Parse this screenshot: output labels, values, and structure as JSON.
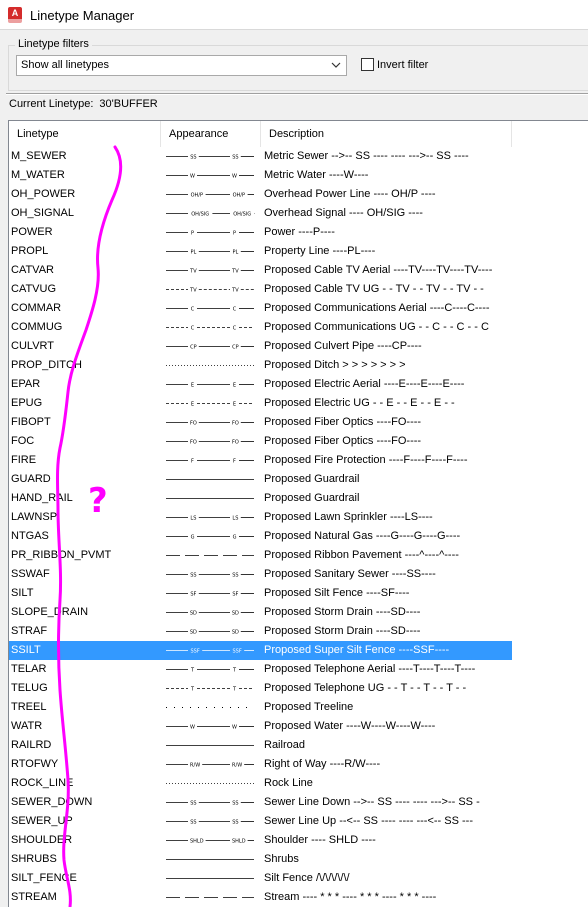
{
  "window": {
    "title": "Linetype Manager",
    "app_icon": "autocad-icon"
  },
  "filters": {
    "group_label": "Linetype filters",
    "selected": "Show all linetypes",
    "invert_label": "Invert filter",
    "invert_checked": false
  },
  "current": {
    "label": "Current Linetype:",
    "value": "30'BUFFER"
  },
  "columns": {
    "linetype": "Linetype",
    "appearance": "Appearance",
    "description": "Description"
  },
  "linetypes": [
    {
      "name": "M_SEWER",
      "desc": "Metric Sewer -->-- SS ---- ---- --->-- SS ----",
      "label": "SS",
      "pattern": "label"
    },
    {
      "name": "M_WATER",
      "desc": "Metric Water ----W----",
      "label": "W",
      "pattern": "label"
    },
    {
      "name": "OH_POWER",
      "desc": "Overhead Power Line ---- OH/P ----",
      "label": "OH/P",
      "pattern": "label"
    },
    {
      "name": "OH_SIGNAL",
      "desc": "Overhead Signal ---- OH/SIG ----",
      "label": "OH/SIG",
      "pattern": "label"
    },
    {
      "name": "POWER",
      "desc": "Power ----P----",
      "label": "P",
      "pattern": "label"
    },
    {
      "name": "PROPL",
      "desc": "Property Line ----PL----",
      "label": "PL",
      "pattern": "label"
    },
    {
      "name": "CATVAR",
      "desc": "Proposed Cable TV Aerial ----TV----TV----TV----",
      "label": "TV",
      "pattern": "label"
    },
    {
      "name": "CATVUG",
      "desc": "Proposed Cable TV UG - - TV - - TV - - TV - -",
      "label": "TV",
      "pattern": "label-dash"
    },
    {
      "name": "COMMAR",
      "desc": "Proposed Communications Aerial ----C----C----",
      "label": "C",
      "pattern": "label"
    },
    {
      "name": "COMMUG",
      "desc": "Proposed Communications UG - - C - - C - - C",
      "label": "C",
      "pattern": "label-dash"
    },
    {
      "name": "CULVRT",
      "desc": "Proposed Culvert Pipe ----CP----",
      "label": "CP",
      "pattern": "label"
    },
    {
      "name": "PROP_DITCH",
      "desc": "Proposed Ditch > > > > > > >",
      "label": "",
      "pattern": "dots"
    },
    {
      "name": "EPAR",
      "desc": "Proposed Electric Aerial ----E----E----E----",
      "label": "E",
      "pattern": "label"
    },
    {
      "name": "EPUG",
      "desc": "Proposed Electric UG - - E - - E - - E - -",
      "label": "E",
      "pattern": "label-dash"
    },
    {
      "name": "FIBOPT",
      "desc": "Proposed Fiber Optics ----FO----",
      "label": "FO",
      "pattern": "label"
    },
    {
      "name": "FOC",
      "desc": "Proposed Fiber Optics ----FO----",
      "label": "FO",
      "pattern": "label"
    },
    {
      "name": "FIRE",
      "desc": "Proposed Fire Protection ----F----F----F----",
      "label": "F",
      "pattern": "label"
    },
    {
      "name": "GUARD",
      "desc": "Proposed Guardrail",
      "label": "",
      "pattern": "solid"
    },
    {
      "name": "HAND_RAIL",
      "desc": "Proposed Guardrail",
      "label": "",
      "pattern": "solid"
    },
    {
      "name": "LAWNSP",
      "desc": "Proposed Lawn Sprinkler ----LS----",
      "label": "LS",
      "pattern": "label"
    },
    {
      "name": "NTGAS",
      "desc": "Proposed Natural Gas ----G----G----G----",
      "label": "G",
      "pattern": "label"
    },
    {
      "name": "PR_RIBBON_PVMT",
      "desc": "Proposed Ribbon Pavement ----^----^----",
      "label": "",
      "pattern": "long-dash"
    },
    {
      "name": "SSWAF",
      "desc": "Proposed Sanitary Sewer ----SS----",
      "label": "SS",
      "pattern": "label"
    },
    {
      "name": "SILT",
      "desc": "Proposed Silt Fence ----SF----",
      "label": "SF",
      "pattern": "label"
    },
    {
      "name": "SLOPE_DRAIN",
      "desc": "Proposed Storm Drain ----SD----",
      "label": "SD",
      "pattern": "label"
    },
    {
      "name": "STRAF",
      "desc": "Proposed Storm Drain ----SD----",
      "label": "SD",
      "pattern": "label"
    },
    {
      "name": "SSILT",
      "desc": "Proposed Super Silt Fence ----SSF----",
      "label": "SSF",
      "pattern": "label",
      "selected": true
    },
    {
      "name": "TELAR",
      "desc": "Proposed Telephone Aerial ----T----T----T----",
      "label": "T",
      "pattern": "label"
    },
    {
      "name": "TELUG",
      "desc": "Proposed Telephone UG - - T - - T - - T - -",
      "label": "T",
      "pattern": "label-dash"
    },
    {
      "name": "TREEL",
      "desc": "Proposed Treeline",
      "label": "",
      "pattern": "sparse-dots"
    },
    {
      "name": "WATR",
      "desc": "Proposed Water ----W----W----W----",
      "label": "W",
      "pattern": "label"
    },
    {
      "name": "RAILRD",
      "desc": "Railroad",
      "label": "",
      "pattern": "solid"
    },
    {
      "name": "RTOFWY",
      "desc": "Right of Way ----R/W----",
      "label": "R/W",
      "pattern": "label"
    },
    {
      "name": "ROCK_LINE",
      "desc": "Rock Line",
      "label": "",
      "pattern": "dots"
    },
    {
      "name": "SEWER_DOWN",
      "desc": "Sewer Line Down -->-- SS ---- ---- --->-- SS -",
      "label": "SS",
      "pattern": "label"
    },
    {
      "name": "SEWER_UP",
      "desc": "Sewer Line Up --<-- SS ---- ---- ---<-- SS ---",
      "label": "SS",
      "pattern": "label"
    },
    {
      "name": "SHOULDER",
      "desc": "Shoulder ---- SHLD ----",
      "label": "SHLD",
      "pattern": "label"
    },
    {
      "name": "SHRUBS",
      "desc": "Shrubs",
      "label": "",
      "pattern": "solid"
    },
    {
      "name": "SILT_FENCE",
      "desc": "Silt Fence /\\/\\/\\/\\/\\/",
      "label": "",
      "pattern": "solid"
    },
    {
      "name": "STREAM",
      "desc": "Stream ---- * * * ---- * * * ---- * * * ----",
      "label": "",
      "pattern": "long-dash"
    }
  ],
  "annotation": {
    "glyph": "?",
    "color": "#ff00ff"
  }
}
